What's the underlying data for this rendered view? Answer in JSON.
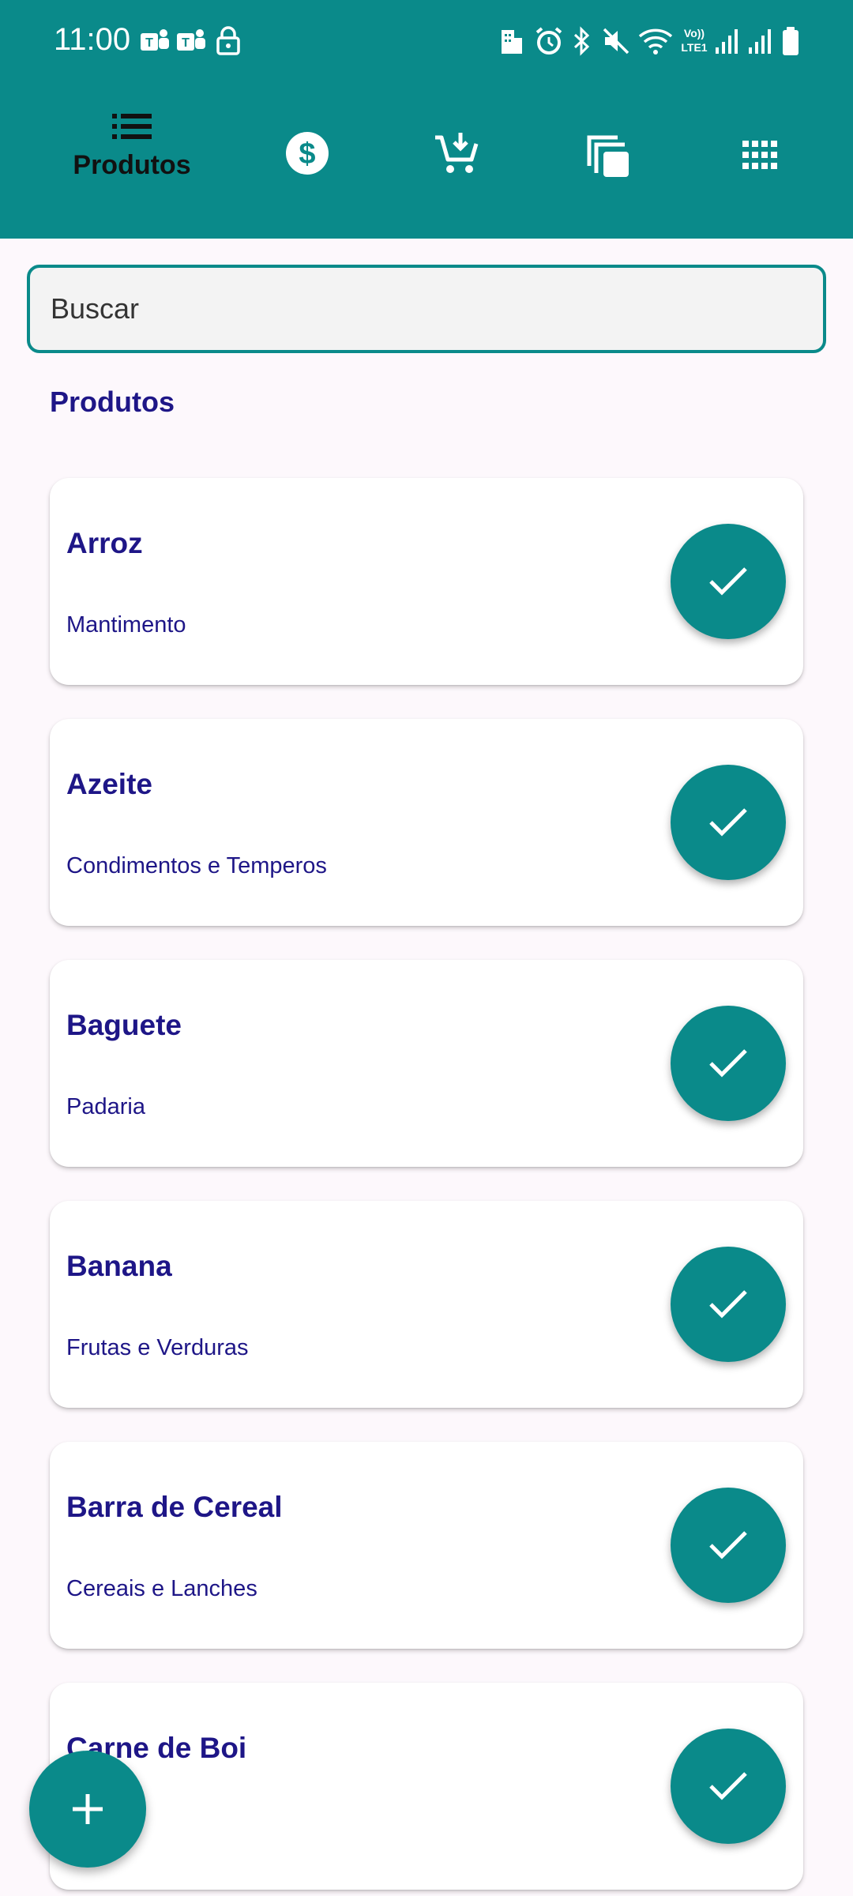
{
  "status_bar": {
    "time": "11:00",
    "icons": [
      "teams-icon",
      "teams-icon",
      "lock-icon",
      "building-icon",
      "alarm-icon",
      "bluetooth-icon",
      "mute-icon",
      "wifi-icon",
      "volte-icon",
      "signal-icon",
      "signal-icon",
      "battery-icon"
    ],
    "volte_label": "Vo)) LTE1"
  },
  "colors": {
    "primary": "#0a8a8a",
    "text_primary": "#1e1687",
    "background": "#fdf8fc",
    "card": "#ffffff"
  },
  "tabs": [
    {
      "icon": "list-icon",
      "label": "Produtos",
      "selected": true
    },
    {
      "icon": "dollar-icon",
      "label": "",
      "selected": false
    },
    {
      "icon": "cart-add-icon",
      "label": "",
      "selected": false
    },
    {
      "icon": "copy-icon",
      "label": "",
      "selected": false
    },
    {
      "icon": "grid-icon",
      "label": "",
      "selected": false
    }
  ],
  "search": {
    "placeholder": "Buscar",
    "value": ""
  },
  "section_title": "Produtos",
  "products": [
    {
      "name": "Arroz",
      "category": "Mantimento"
    },
    {
      "name": "Azeite",
      "category": "Condimentos e Temperos"
    },
    {
      "name": "Baguete",
      "category": "Padaria"
    },
    {
      "name": "Banana",
      "category": "Frutas e Verduras"
    },
    {
      "name": "Barra de Cereal",
      "category": "Cereais e Lanches"
    },
    {
      "name": "Carne de Boi",
      "category": ""
    }
  ],
  "fab": {
    "icon": "plus-icon"
  }
}
